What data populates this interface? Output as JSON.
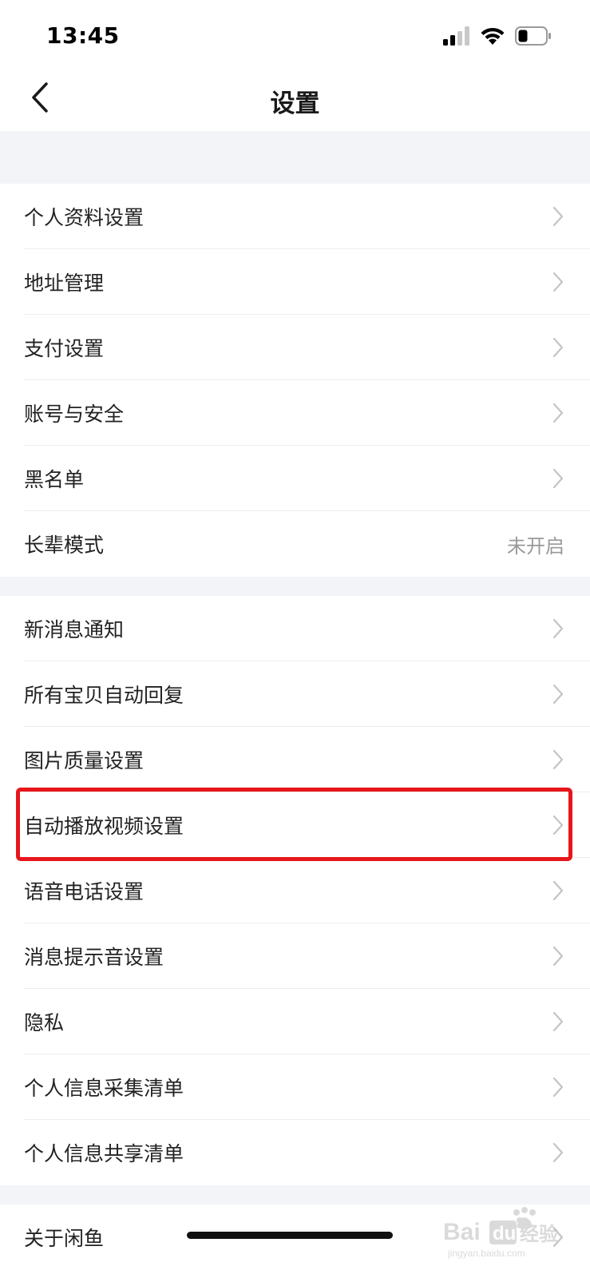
{
  "status_bar": {
    "time": "13:45",
    "icons": [
      "cellular-signal-icon",
      "wifi-icon",
      "battery-icon"
    ]
  },
  "nav": {
    "back_icon": "chevron-left-icon",
    "title": "设置"
  },
  "group1": [
    {
      "label": "个人资料设置",
      "value": ""
    },
    {
      "label": "地址管理",
      "value": ""
    },
    {
      "label": "支付设置",
      "value": ""
    },
    {
      "label": "账号与安全",
      "value": ""
    },
    {
      "label": "黑名单",
      "value": ""
    },
    {
      "label": "长辈模式",
      "value": "未开启"
    }
  ],
  "group2": [
    {
      "label": "新消息通知",
      "value": ""
    },
    {
      "label": "所有宝贝自动回复",
      "value": ""
    },
    {
      "label": "图片质量设置",
      "value": ""
    },
    {
      "label": "自动播放视频设置",
      "value": ""
    },
    {
      "label": "语音电话设置",
      "value": ""
    },
    {
      "label": "消息提示音设置",
      "value": ""
    },
    {
      "label": "隐私",
      "value": ""
    },
    {
      "label": "个人信息采集清单",
      "value": ""
    },
    {
      "label": "个人信息共享清单",
      "value": ""
    }
  ],
  "group3": [
    {
      "label": "关于闲鱼",
      "value": ""
    }
  ],
  "annotation": {
    "highlight_color": "#e6161a",
    "highlighted_item": "自动播放视频设置"
  },
  "watermark": {
    "brand": "Bai du 经验",
    "url": "jingyan.baidu.com"
  },
  "colors": {
    "section_gap": "#f3f4f7",
    "text_primary": "#222222",
    "text_secondary": "#999999",
    "chevron": "#c4c4c4"
  }
}
